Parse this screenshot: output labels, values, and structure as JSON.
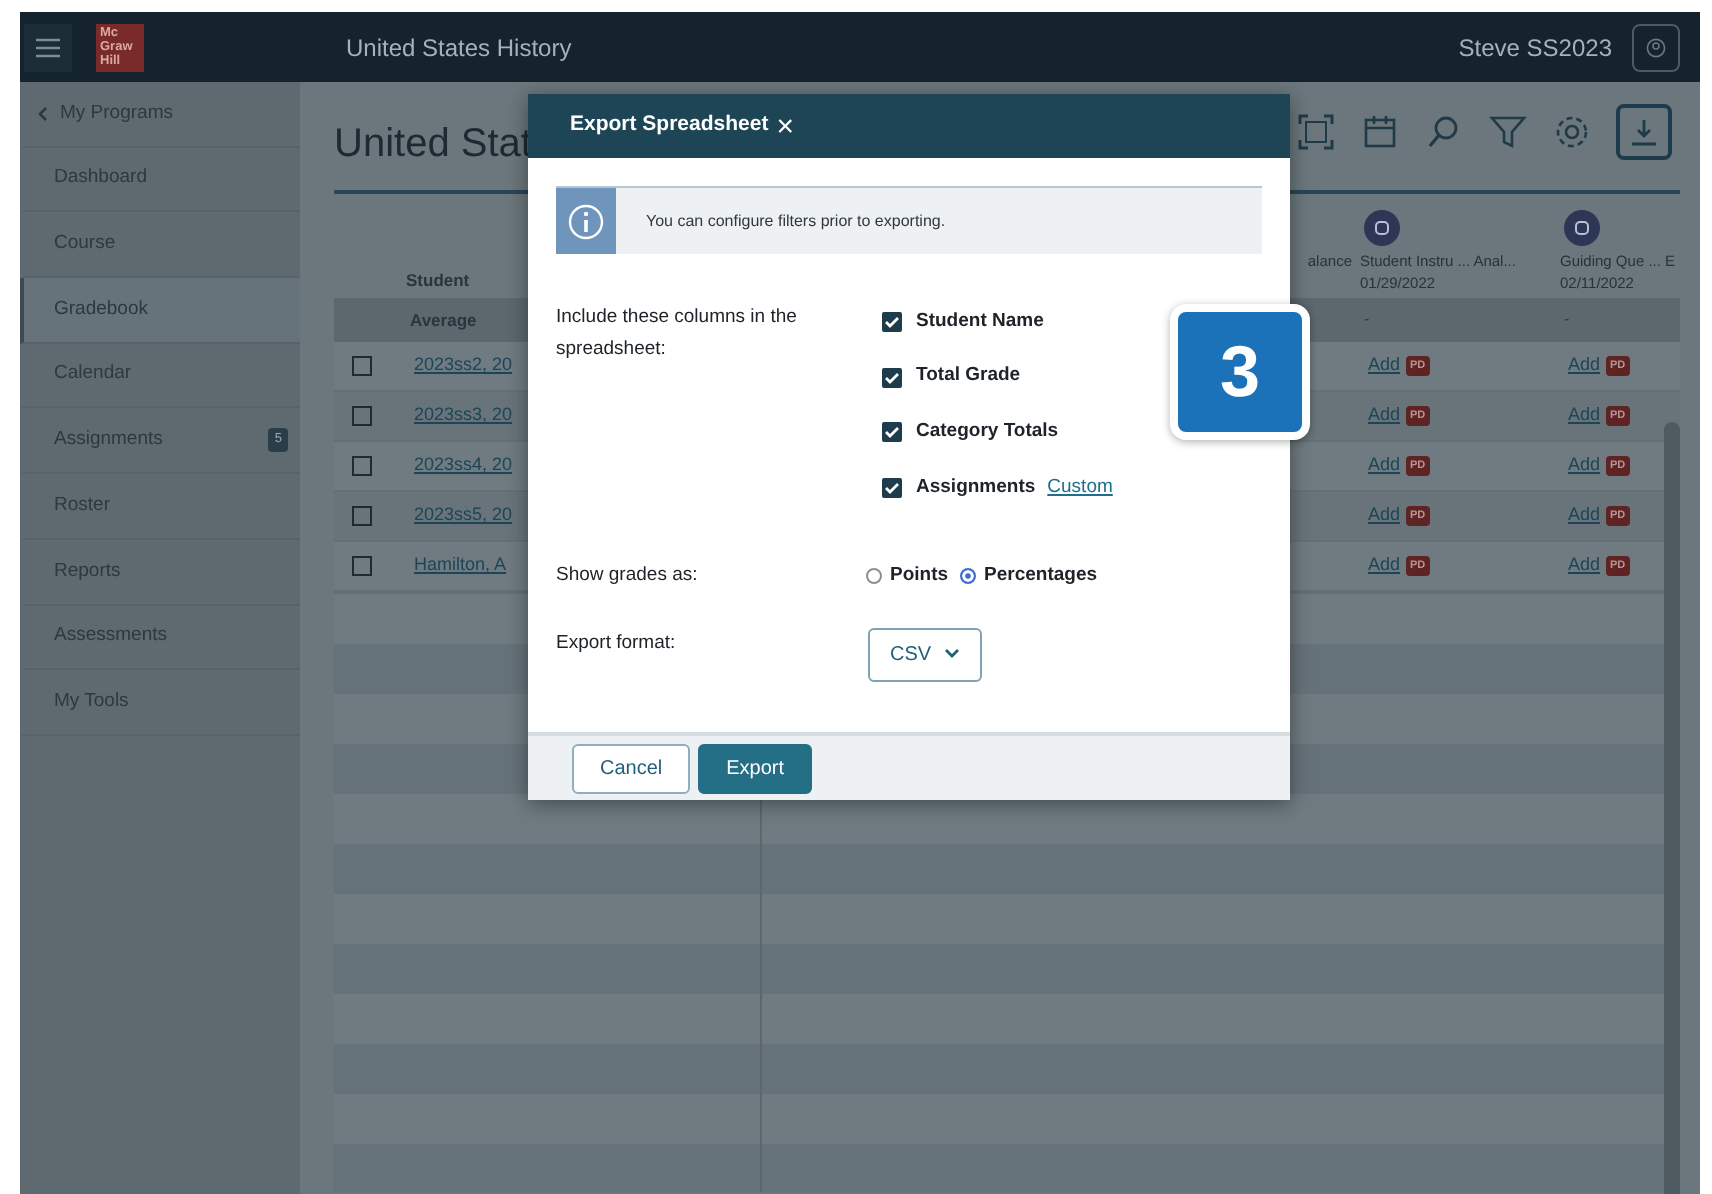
{
  "app_bar": {
    "logo": [
      "Mc",
      "Graw",
      "Hill"
    ],
    "title": "United States History",
    "user": "Steve SS2023"
  },
  "sidebar": {
    "back": "My Programs",
    "items": [
      {
        "label": "Dashboard",
        "selected": false
      },
      {
        "label": "Course",
        "selected": false
      },
      {
        "label": "Gradebook",
        "selected": true
      },
      {
        "label": "Calendar",
        "selected": false
      },
      {
        "label": "Assignments",
        "selected": false,
        "badge": "5"
      },
      {
        "label": "Roster",
        "selected": false
      },
      {
        "label": "Reports",
        "selected": false
      },
      {
        "label": "Assessments",
        "selected": false
      },
      {
        "label": "My Tools",
        "selected": false
      }
    ]
  },
  "page": {
    "title": "United Stat"
  },
  "table": {
    "student_header": "Student",
    "average_label": "Average",
    "columns": [
      {
        "title": "alance"
      },
      {
        "title": "Student Instru ... Anal...",
        "date": "01/29/2022",
        "average": "-"
      },
      {
        "title": "Guiding Que ... E",
        "date": "02/11/2022",
        "average": "-"
      }
    ],
    "rows": [
      {
        "name": "2023ss2, 20",
        "checked": false,
        "cells": [
          "",
          {
            "link": "Add",
            "tag": "PD"
          },
          {
            "link": "Add",
            "tag": "PD"
          }
        ]
      },
      {
        "name": "2023ss3, 20",
        "checked": false,
        "cells": [
          "",
          {
            "link": "Add",
            "tag": "PD"
          },
          {
            "link": "Add",
            "tag": "PD"
          }
        ]
      },
      {
        "name": "2023ss4, 20",
        "checked": false,
        "cells": [
          "",
          {
            "link": "Add",
            "tag": "PD"
          },
          {
            "link": "Add",
            "tag": "PD"
          }
        ]
      },
      {
        "name": "2023ss5, 20",
        "checked": false,
        "cells": [
          "",
          {
            "link": "Add",
            "tag": "PD"
          },
          {
            "link": "Add",
            "tag": "PD"
          }
        ]
      },
      {
        "name": "Hamilton, A",
        "checked": false,
        "cells": [
          "",
          {
            "link": "Add",
            "tag": "PD"
          },
          {
            "link": "Add",
            "tag": "PD"
          }
        ]
      }
    ]
  },
  "modal": {
    "title": "Export Spreadsheet",
    "close": "×",
    "info": "You can configure filters prior to exporting.",
    "columns_label": "Include these columns in the spreadsheet:",
    "options": [
      {
        "label": "Student Name",
        "checked": true
      },
      {
        "label": "Total Grade",
        "checked": true
      },
      {
        "label": "Category Totals",
        "checked": true
      },
      {
        "label": "Assignments",
        "checked": true,
        "link": "Custom"
      }
    ],
    "grades_label": "Show grades as:",
    "grade_modes": [
      {
        "label": "Points",
        "selected": false
      },
      {
        "label": "Percentages",
        "selected": true
      }
    ],
    "format_label": "Export format:",
    "format": "CSV",
    "buttons": [
      {
        "label": "Cancel",
        "kind": "secondary"
      },
      {
        "label": "Export",
        "kind": "primary"
      }
    ]
  },
  "step_badge": "3"
}
